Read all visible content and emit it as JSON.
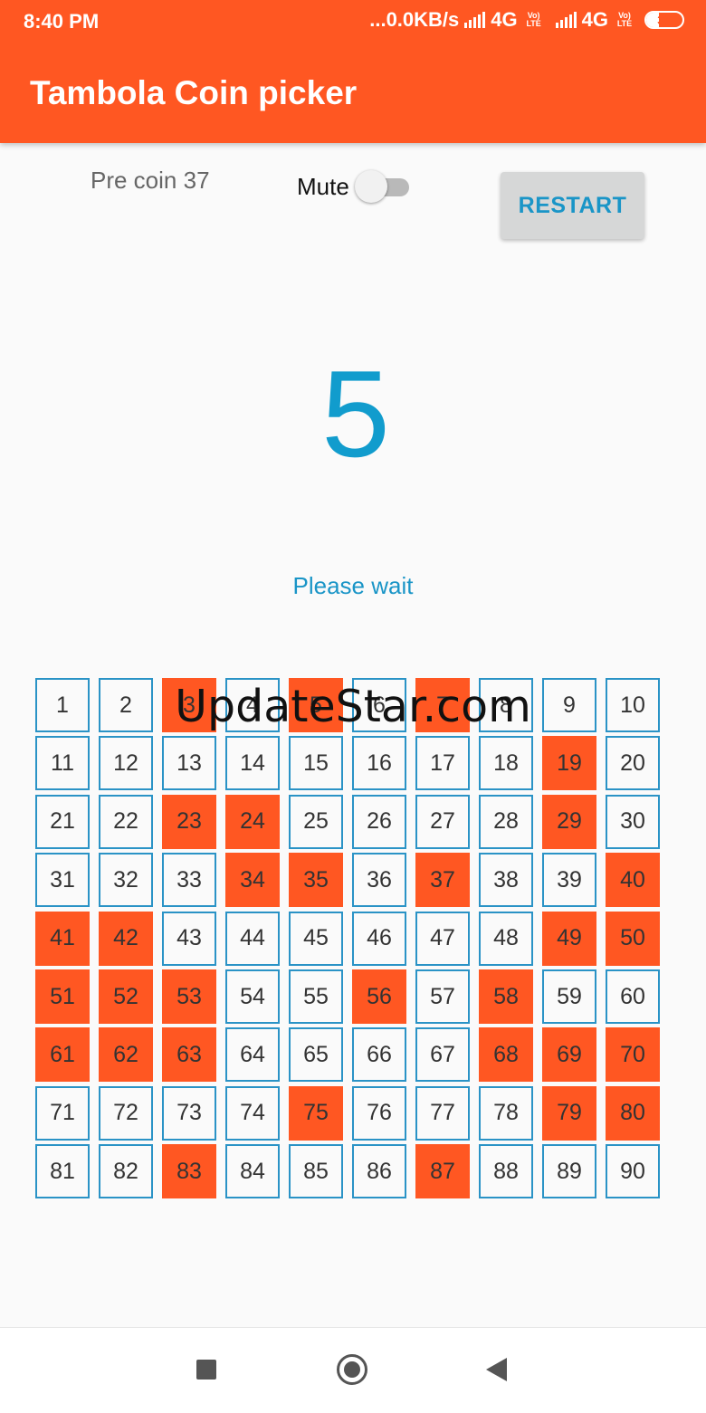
{
  "status_bar": {
    "time": "8:40 PM",
    "network_speed": "...0.0KB/s",
    "network_label_1": "4G",
    "volte_1": "Vo) LTE",
    "network_label_2": "4G",
    "volte_2": "Vo) LTE",
    "battery_level": "36",
    "icons": [
      "signal-icon",
      "signal-icon",
      "battery-icon"
    ]
  },
  "app_bar": {
    "title": "Tambola Coin picker",
    "color": "#ff5722"
  },
  "controls": {
    "pre_coin_label": "Pre coin 37",
    "mute_label": "Mute",
    "mute_on": false,
    "restart_label": "RESTART"
  },
  "current_number": "5",
  "status_message": "Please wait",
  "board": {
    "called_color": "#ff5722",
    "border_color": "#2a93c6",
    "numbers": [
      1,
      2,
      3,
      4,
      5,
      6,
      7,
      8,
      9,
      10,
      11,
      12,
      13,
      14,
      15,
      16,
      17,
      18,
      19,
      20,
      21,
      22,
      23,
      24,
      25,
      26,
      27,
      28,
      29,
      30,
      31,
      32,
      33,
      34,
      35,
      36,
      37,
      38,
      39,
      40,
      41,
      42,
      43,
      44,
      45,
      46,
      47,
      48,
      49,
      50,
      51,
      52,
      53,
      54,
      55,
      56,
      57,
      58,
      59,
      60,
      61,
      62,
      63,
      64,
      65,
      66,
      67,
      68,
      69,
      70,
      71,
      72,
      73,
      74,
      75,
      76,
      77,
      78,
      79,
      80,
      81,
      82,
      83,
      84,
      85,
      86,
      87,
      88,
      89,
      90
    ],
    "called": [
      3,
      5,
      7,
      19,
      23,
      24,
      29,
      34,
      35,
      37,
      40,
      41,
      42,
      49,
      50,
      51,
      52,
      53,
      56,
      58,
      61,
      62,
      63,
      68,
      69,
      70,
      75,
      79,
      80,
      83,
      87
    ]
  },
  "watermark": "UpdateStar.com",
  "nav_bar": {
    "icons": [
      "recents-icon",
      "home-icon",
      "back-icon"
    ]
  }
}
